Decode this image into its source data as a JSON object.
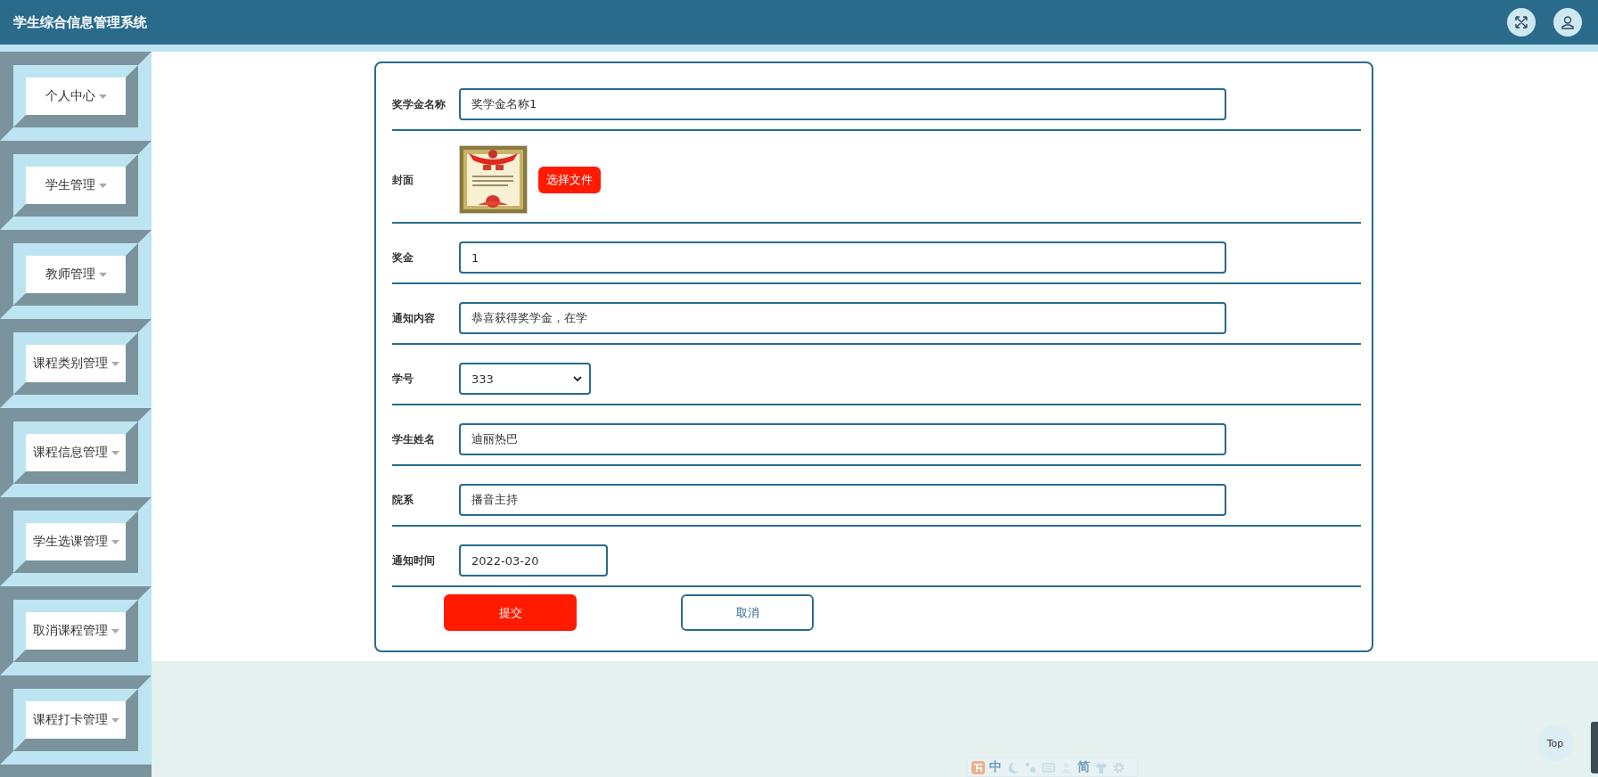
{
  "header": {
    "title": "学生综合信息管理系统"
  },
  "sidebar": {
    "items": [
      {
        "label": "个人中心"
      },
      {
        "label": "学生管理"
      },
      {
        "label": "教师管理"
      },
      {
        "label": "课程类别管理"
      },
      {
        "label": "课程信息管理"
      },
      {
        "label": "学生选课管理"
      },
      {
        "label": "取消课程管理"
      },
      {
        "label": "课程打卡管理"
      }
    ]
  },
  "form": {
    "fields": [
      {
        "kind": "text",
        "label": "奖学金名称",
        "value": "奖学金名称1"
      },
      {
        "label": "封面",
        "button": "选择文件"
      },
      {
        "kind": "text",
        "label": "奖金",
        "value": "1"
      },
      {
        "kind": "text",
        "label": "通知内容",
        "value": "恭喜获得奖学金，在学"
      },
      {
        "kind": "select",
        "label": "学号",
        "value": "333"
      },
      {
        "kind": "text",
        "label": "学生姓名",
        "value": "迪丽热巴"
      },
      {
        "kind": "text",
        "label": "院系",
        "value": "播音主持"
      },
      {
        "kind": "date",
        "label": "通知时间",
        "value": "2022-03-20"
      }
    ],
    "buttons": [
      {
        "kind": "primary",
        "label": "提交"
      },
      {
        "kind": "secondary",
        "label": "取消"
      }
    ]
  },
  "back_to_top": {
    "label": "Top"
  },
  "ime_toolbar": {
    "items": [
      {
        "kind": "logo"
      },
      {
        "kind": "text",
        "label": "中"
      },
      {
        "kind": "moon"
      },
      {
        "kind": "dots"
      },
      {
        "kind": "keyboard"
      },
      {
        "kind": "person"
      },
      {
        "kind": "text",
        "label": "简"
      },
      {
        "kind": "shirt"
      },
      {
        "kind": "gear"
      }
    ]
  }
}
